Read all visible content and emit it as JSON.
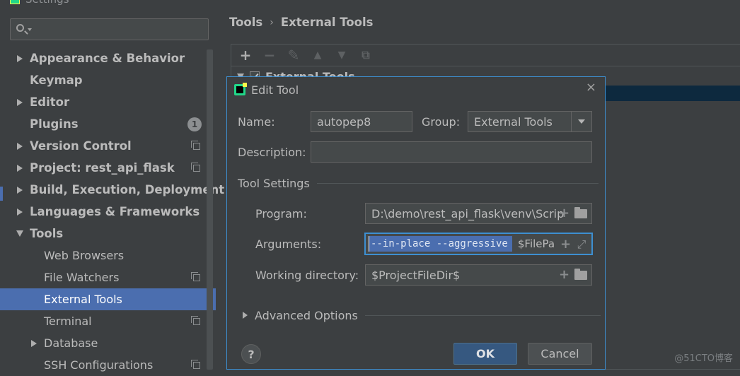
{
  "window": {
    "title": "Settings"
  },
  "search": {
    "placeholder": ""
  },
  "sidebar": {
    "items": [
      {
        "label": "Appearance & Behavior"
      },
      {
        "label": "Keymap"
      },
      {
        "label": "Editor"
      },
      {
        "label": "Plugins",
        "badge": "1"
      },
      {
        "label": "Version Control"
      },
      {
        "label": "Project: rest_api_flask"
      },
      {
        "label": "Build, Execution, Deployment"
      },
      {
        "label": "Languages & Frameworks"
      },
      {
        "label": "Tools"
      },
      {
        "label": "Web Browsers"
      },
      {
        "label": "File Watchers"
      },
      {
        "label": "External Tools"
      },
      {
        "label": "Terminal"
      },
      {
        "label": "Database"
      },
      {
        "label": "SSH Configurations"
      }
    ]
  },
  "breadcrumb": {
    "root": "Tools",
    "separator": "›",
    "current": "External Tools"
  },
  "tools_tree": {
    "group_label": "External Tools"
  },
  "dialog": {
    "title": "Edit Tool",
    "close": "×",
    "name_label": "Name:",
    "name_value": "autopep8",
    "group_label": "Group:",
    "group_value": "External Tools",
    "description_label": "Description:",
    "description_value": "",
    "tool_settings_label": "Tool Settings",
    "program_label": "Program:",
    "program_value": "D:\\demo\\rest_api_flask\\venv\\Scrip",
    "arguments_label": "Arguments:",
    "arguments_selected": "--in-place --aggressive",
    "arguments_rest": "$FilePa",
    "workdir_label": "Working directory:",
    "workdir_value": "$ProjectFileDir$",
    "advanced_label": "Advanced Options",
    "help": "?",
    "ok": "OK",
    "cancel": "Cancel"
  },
  "watermark": "@51CTO博客",
  "colors": {
    "accent": "#4b6eaf",
    "focus": "#3d8fd1",
    "ok_button": "#365880"
  }
}
